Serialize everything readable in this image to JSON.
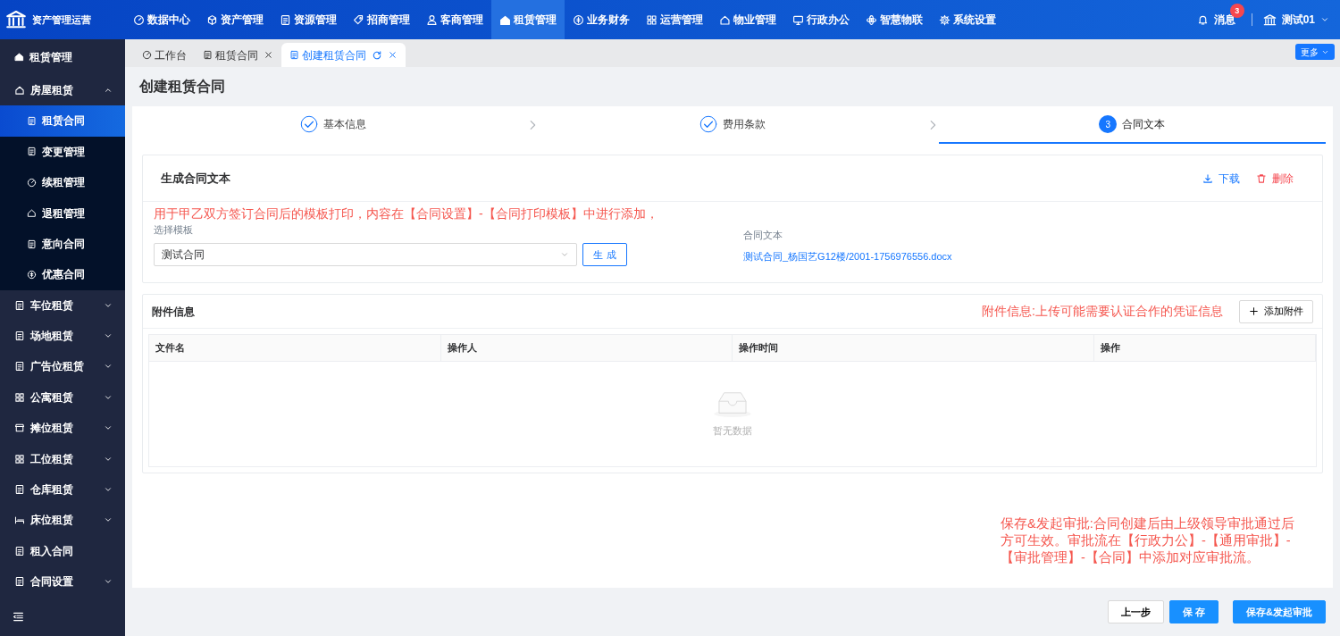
{
  "app": {
    "title": "资产管理运营"
  },
  "top_nav": [
    {
      "label": "数据中心",
      "selected": false
    },
    {
      "label": "资产管理",
      "selected": false
    },
    {
      "label": "资源管理",
      "selected": false
    },
    {
      "label": "招商管理",
      "selected": false
    },
    {
      "label": "客商管理",
      "selected": false
    },
    {
      "label": "租赁管理",
      "selected": true
    },
    {
      "label": "业务财务",
      "selected": false
    },
    {
      "label": "运营管理",
      "selected": false
    },
    {
      "label": "物业管理",
      "selected": false
    },
    {
      "label": "行政办公",
      "selected": false
    },
    {
      "label": "智慧物联",
      "selected": false
    },
    {
      "label": "系统设置",
      "selected": false
    }
  ],
  "notifications": {
    "label": "消息",
    "count": "3"
  },
  "user": {
    "name": "测试01"
  },
  "sidebar": {
    "title": "租赁管理",
    "items": [
      {
        "label": "房屋租赁",
        "kind": "group",
        "expanded": true,
        "children": [
          {
            "label": "租赁合同",
            "selected": true
          },
          {
            "label": "变更管理",
            "selected": false
          },
          {
            "label": "续租管理",
            "selected": false
          },
          {
            "label": "退租管理",
            "selected": false
          },
          {
            "label": "意向合同",
            "selected": false
          },
          {
            "label": "优惠合同",
            "selected": false
          }
        ]
      },
      {
        "label": "车位租赁",
        "kind": "group",
        "expanded": false
      },
      {
        "label": "场地租赁",
        "kind": "group",
        "expanded": false
      },
      {
        "label": "广告位租赁",
        "kind": "group",
        "expanded": false
      },
      {
        "label": "公寓租赁",
        "kind": "group",
        "expanded": false
      },
      {
        "label": "摊位租赁",
        "kind": "group",
        "expanded": false
      },
      {
        "label": "工位租赁",
        "kind": "group",
        "expanded": false
      },
      {
        "label": "仓库租赁",
        "kind": "group",
        "expanded": false
      },
      {
        "label": "床位租赁",
        "kind": "group",
        "expanded": false
      },
      {
        "label": "租入合同",
        "kind": "link"
      },
      {
        "label": "合同设置",
        "kind": "group",
        "expanded": false
      }
    ]
  },
  "tabs": [
    {
      "label": "工作台",
      "selected": false,
      "closable": false
    },
    {
      "label": "租赁合同",
      "selected": false,
      "closable": true
    },
    {
      "label": "创建租赁合同",
      "selected": true,
      "closable": true
    }
  ],
  "more_button": "更多",
  "page_title": "创建租赁合同",
  "steps": [
    {
      "label": "基本信息",
      "done": true,
      "current": false
    },
    {
      "label": "费用条款",
      "done": true,
      "current": false
    },
    {
      "label": "合同文本",
      "done": false,
      "current": true,
      "number": "3"
    }
  ],
  "generate_section": {
    "title": "生成合同文本",
    "actions": [
      {
        "label": "下载",
        "kind": "download"
      },
      {
        "label": "删除",
        "kind": "delete"
      }
    ],
    "note": "用于甲乙双方签订合同后的模板打印，内容在【合同设置】-【合同打印模板】中进行添加，",
    "template_label": "选择模板",
    "template_value": "测试合同",
    "generate_button": "生 成",
    "file_label": "合同文本",
    "file_link": "测试合同_杨国艺G12楼/2001-1756976556.docx"
  },
  "attachments": {
    "title": "附件信息",
    "note": "附件信息:上传可能需要认证合作的凭证信息",
    "add_button": "添加附件",
    "table": {
      "columns": [
        "文件名",
        "操作人",
        "操作时间",
        "操作"
      ],
      "empty_text": "暂无数据"
    }
  },
  "approval_note": "保存&发起审批:合同创建后由上级领导审批通过后方可生效。审批流在【行政力公】-【通用审批】-【审批管理】-【合同】中添加对应审批流。",
  "footer_buttons": [
    {
      "label": "上一步",
      "kind": "default"
    },
    {
      "label": "保 存",
      "kind": "primary"
    },
    {
      "label": "保存&发起审批",
      "kind": "primary"
    }
  ]
}
